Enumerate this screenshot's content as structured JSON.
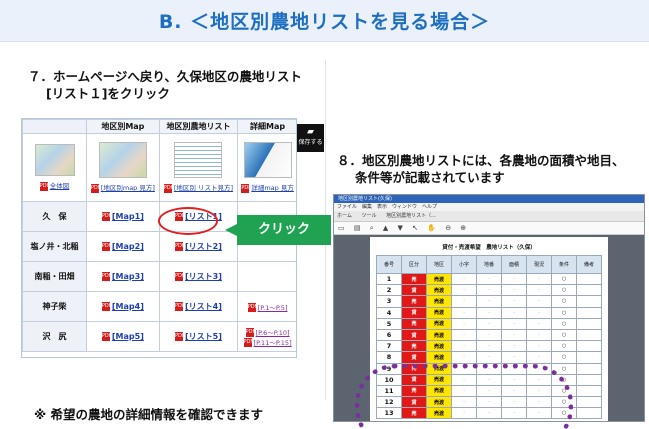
{
  "title": "B. ＜地区別農地リストを見る場合＞",
  "step7": {
    "line1": "７．ホームページへ戻り、久保地区の農地リスト",
    "line2": "[リスト１]をクリック"
  },
  "step8": {
    "line1": "８．地区別農地リストには、各農地の面積や地目、",
    "line2": "条件等が記載されています"
  },
  "note": "※ 希望の農地の詳細情報を確認できます",
  "table": {
    "headers": [
      "地区別Map",
      "地区別農地リスト",
      "詳細Map"
    ],
    "thumb_captions": [
      "全体図",
      "[地区別map 見方]",
      "[地区別 リスト見方]",
      "詳細map 見方"
    ],
    "rows": [
      {
        "area": "久　保",
        "map": "[Map1]",
        "list": "[リスト1]",
        "detail": ""
      },
      {
        "area": "塩ノ井・北稲",
        "map": "[Map2]",
        "list": "[リスト2]",
        "detail": ""
      },
      {
        "area": "南稲・田畑",
        "map": "[Map3]",
        "list": "[リスト3]",
        "detail": ""
      },
      {
        "area": "神子柴",
        "map": "[Map4]",
        "list": "[リスト4]",
        "detail": "[P.1～P.5]"
      },
      {
        "area": "沢　尻",
        "map": "[Map5]",
        "list": "[リスト5]",
        "detail": "[P.6～P.10]",
        "detail2": "[P.11～P.15]"
      }
    ]
  },
  "save_button": {
    "label": "保存する",
    "icon": "folder-icon"
  },
  "callout": "クリック",
  "viewer": {
    "window_title": "地区別農地リスト(久保)",
    "menu": "ファイル　編集　表示　ウィンドウ　ヘルプ",
    "tabs": [
      "ホーム",
      "ツール",
      "地区別農地リスト（..."
    ],
    "page_title": "貸付・売渡希望　農地リスト（久保）",
    "columns": [
      "番号",
      "区分",
      "地区",
      "小字",
      "地番",
      "面積",
      "現況",
      "条件",
      "備考"
    ],
    "rows": [
      {
        "no": "1",
        "type": "売",
        "kind": "売渡"
      },
      {
        "no": "2",
        "type": "貸",
        "kind": "売渡"
      },
      {
        "no": "3",
        "type": "売",
        "kind": "売渡"
      },
      {
        "no": "4",
        "type": "貸",
        "kind": "売渡"
      },
      {
        "no": "5",
        "type": "売",
        "kind": "売渡"
      },
      {
        "no": "6",
        "type": "貸",
        "kind": "売渡"
      },
      {
        "no": "7",
        "type": "売",
        "kind": "売渡"
      },
      {
        "no": "8",
        "type": "貸",
        "kind": "売渡"
      },
      {
        "no": "9",
        "type": "売",
        "kind": "売渡"
      },
      {
        "no": "10",
        "type": "貸",
        "kind": "売渡"
      },
      {
        "no": "11",
        "type": "売",
        "kind": "売渡"
      },
      {
        "no": "12",
        "type": "貸",
        "kind": "売渡"
      },
      {
        "no": "13",
        "type": "売",
        "kind": "売渡"
      }
    ]
  },
  "colors": {
    "accent": "#1f6fc1",
    "callout": "#1fa353",
    "highlight": "#e51d1d",
    "dotted": "#7a2f9c"
  }
}
